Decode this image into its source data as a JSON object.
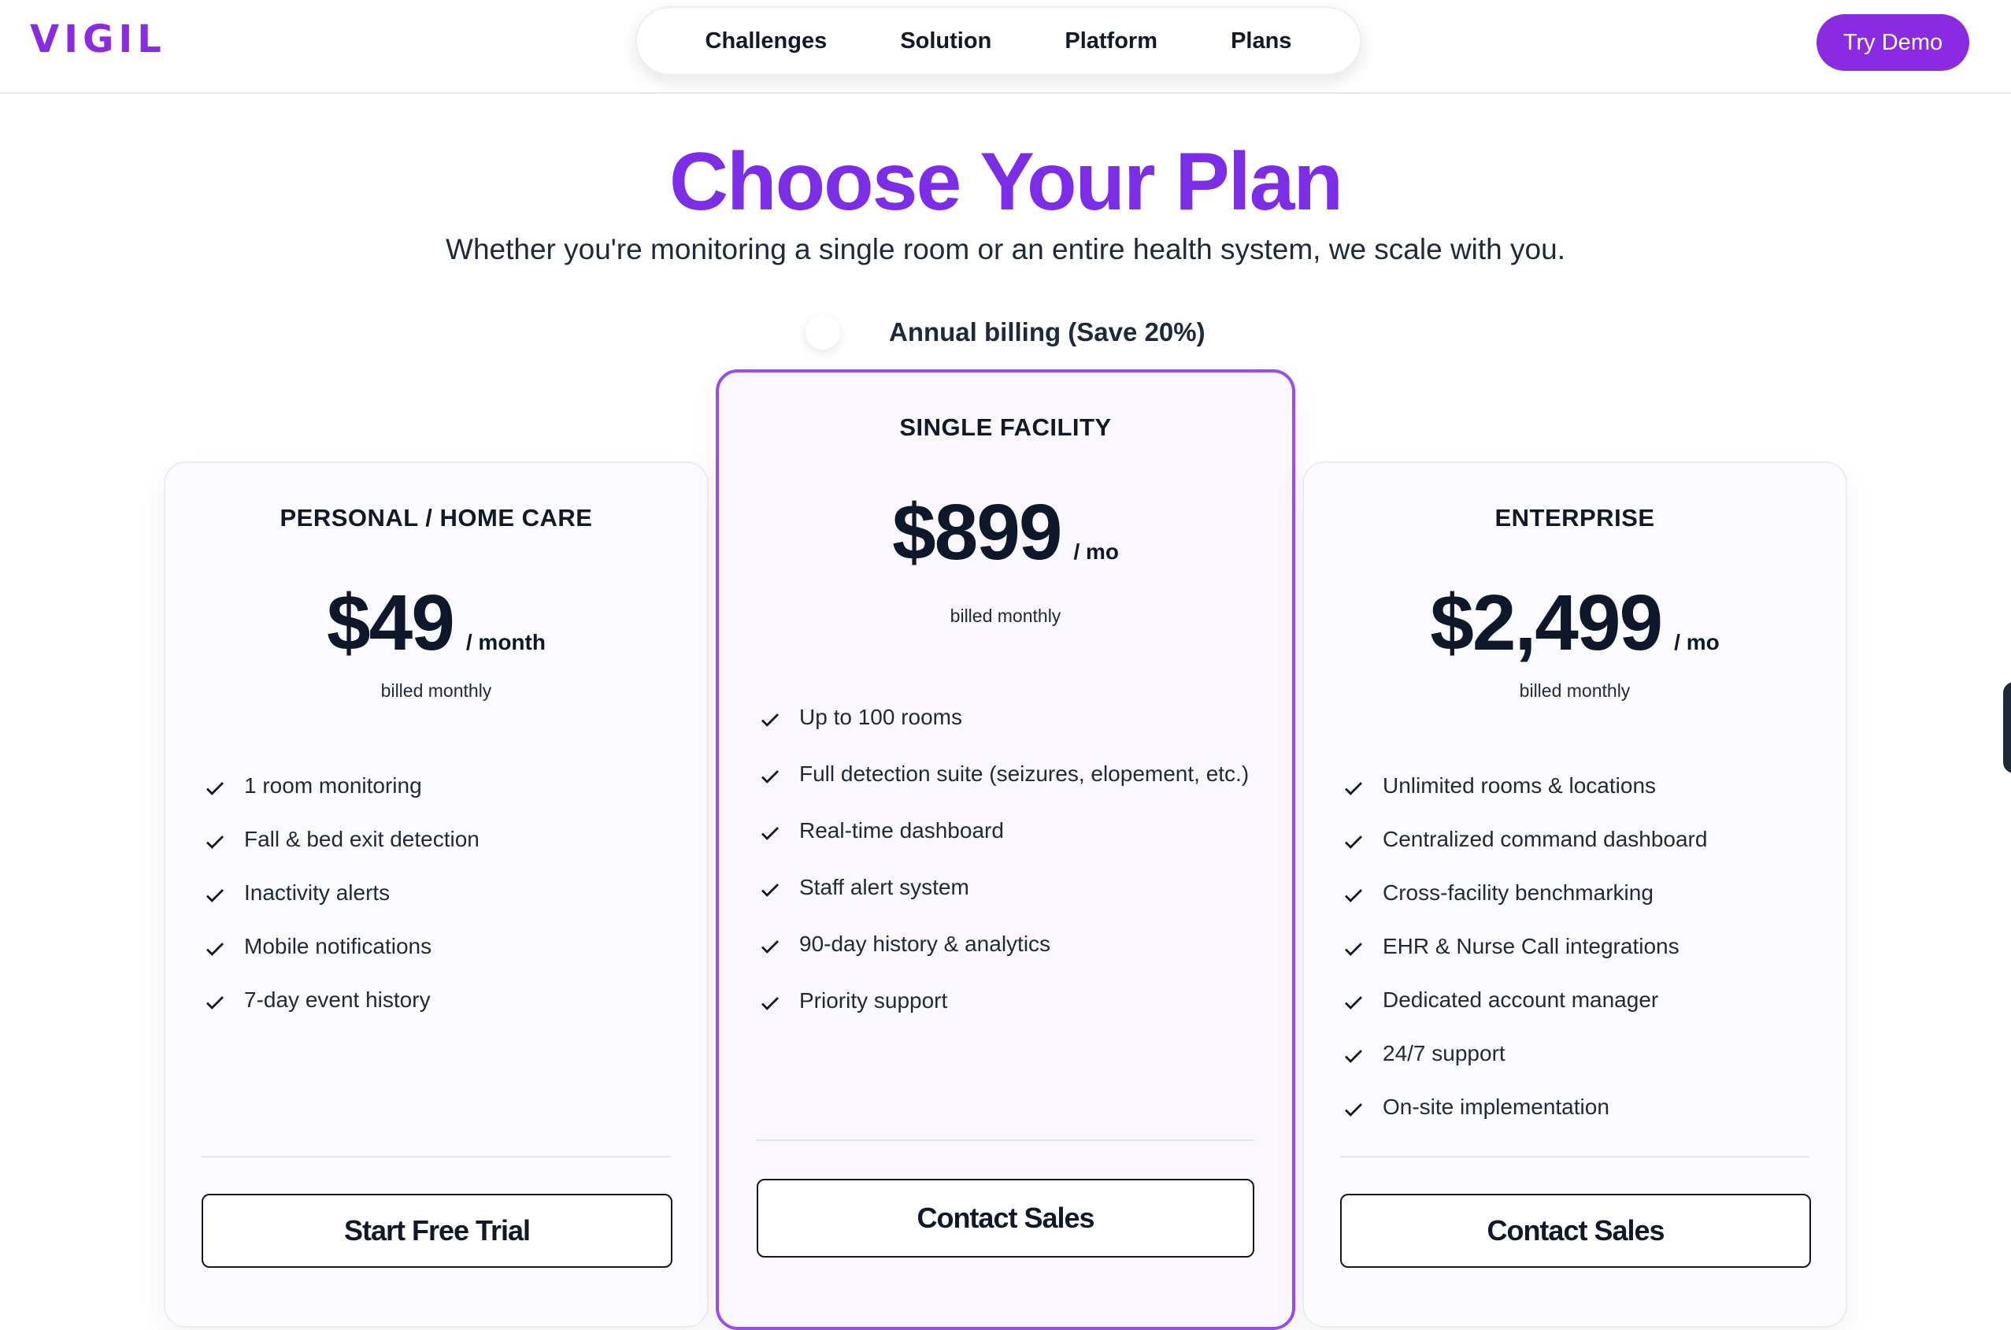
{
  "brand": {
    "logo": "VIGIL",
    "accent": "#8a2be2"
  },
  "nav": {
    "items": [
      "Challenges",
      "Solution",
      "Platform",
      "Plans"
    ]
  },
  "header": {
    "cta_label": "Try Demo"
  },
  "hero": {
    "title": "Choose Your Plan",
    "subtitle": "Whether you're monitoring a single room or an entire health system, we scale with you.",
    "billing_label": "Annual billing (Save 20%)"
  },
  "plans": [
    {
      "name": "PERSONAL / HOME CARE",
      "price": "$49",
      "period": "/ month",
      "billed": "billed monthly",
      "features": [
        "1 room monitoring",
        "Fall & bed exit detection",
        "Inactivity alerts",
        "Mobile notifications",
        "7-day event history"
      ],
      "cta": "Start Free Trial"
    },
    {
      "name": "SINGLE FACILITY",
      "price": "$899",
      "period": "/ mo",
      "billed": "billed monthly",
      "features": [
        "Up to 100 rooms",
        "Full detection suite (seizures, elopement, etc.)",
        "Real-time dashboard",
        "Staff alert system",
        "90-day history & analytics",
        "Priority support"
      ],
      "cta": "Contact Sales"
    },
    {
      "name": "ENTERPRISE",
      "price": "$2,499",
      "period": "/ mo",
      "billed": "billed monthly",
      "features": [
        "Unlimited rooms & locations",
        "Centralized command dashboard",
        "Cross-facility benchmarking",
        "EHR & Nurse Call integrations",
        "Dedicated account manager",
        "24/7 support",
        "On-site implementation"
      ],
      "cta": "Contact Sales"
    }
  ]
}
